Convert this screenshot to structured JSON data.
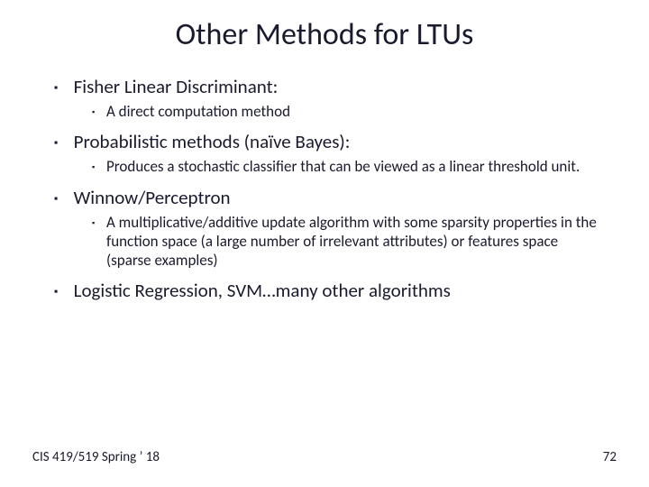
{
  "title": "Other Methods for LTUs",
  "items": [
    {
      "label": "Fisher Linear Discriminant:",
      "sub": [
        "A direct computation method"
      ]
    },
    {
      "label": "Probabilistic methods (naïve Bayes):",
      "sub": [
        "Produces a stochastic classifier that can be viewed as a linear threshold unit."
      ]
    },
    {
      "label": "Winnow/Perceptron",
      "sub": [
        "A multiplicative/additive update algorithm with some sparsity properties in the function space (a large number of irrelevant attributes) or features space (sparse examples)"
      ]
    },
    {
      "label": "Logistic Regression, SVM…many other algorithms",
      "sub": []
    }
  ],
  "footer": {
    "left": "CIS 419/519 Spring ’ 18",
    "right": "72"
  }
}
